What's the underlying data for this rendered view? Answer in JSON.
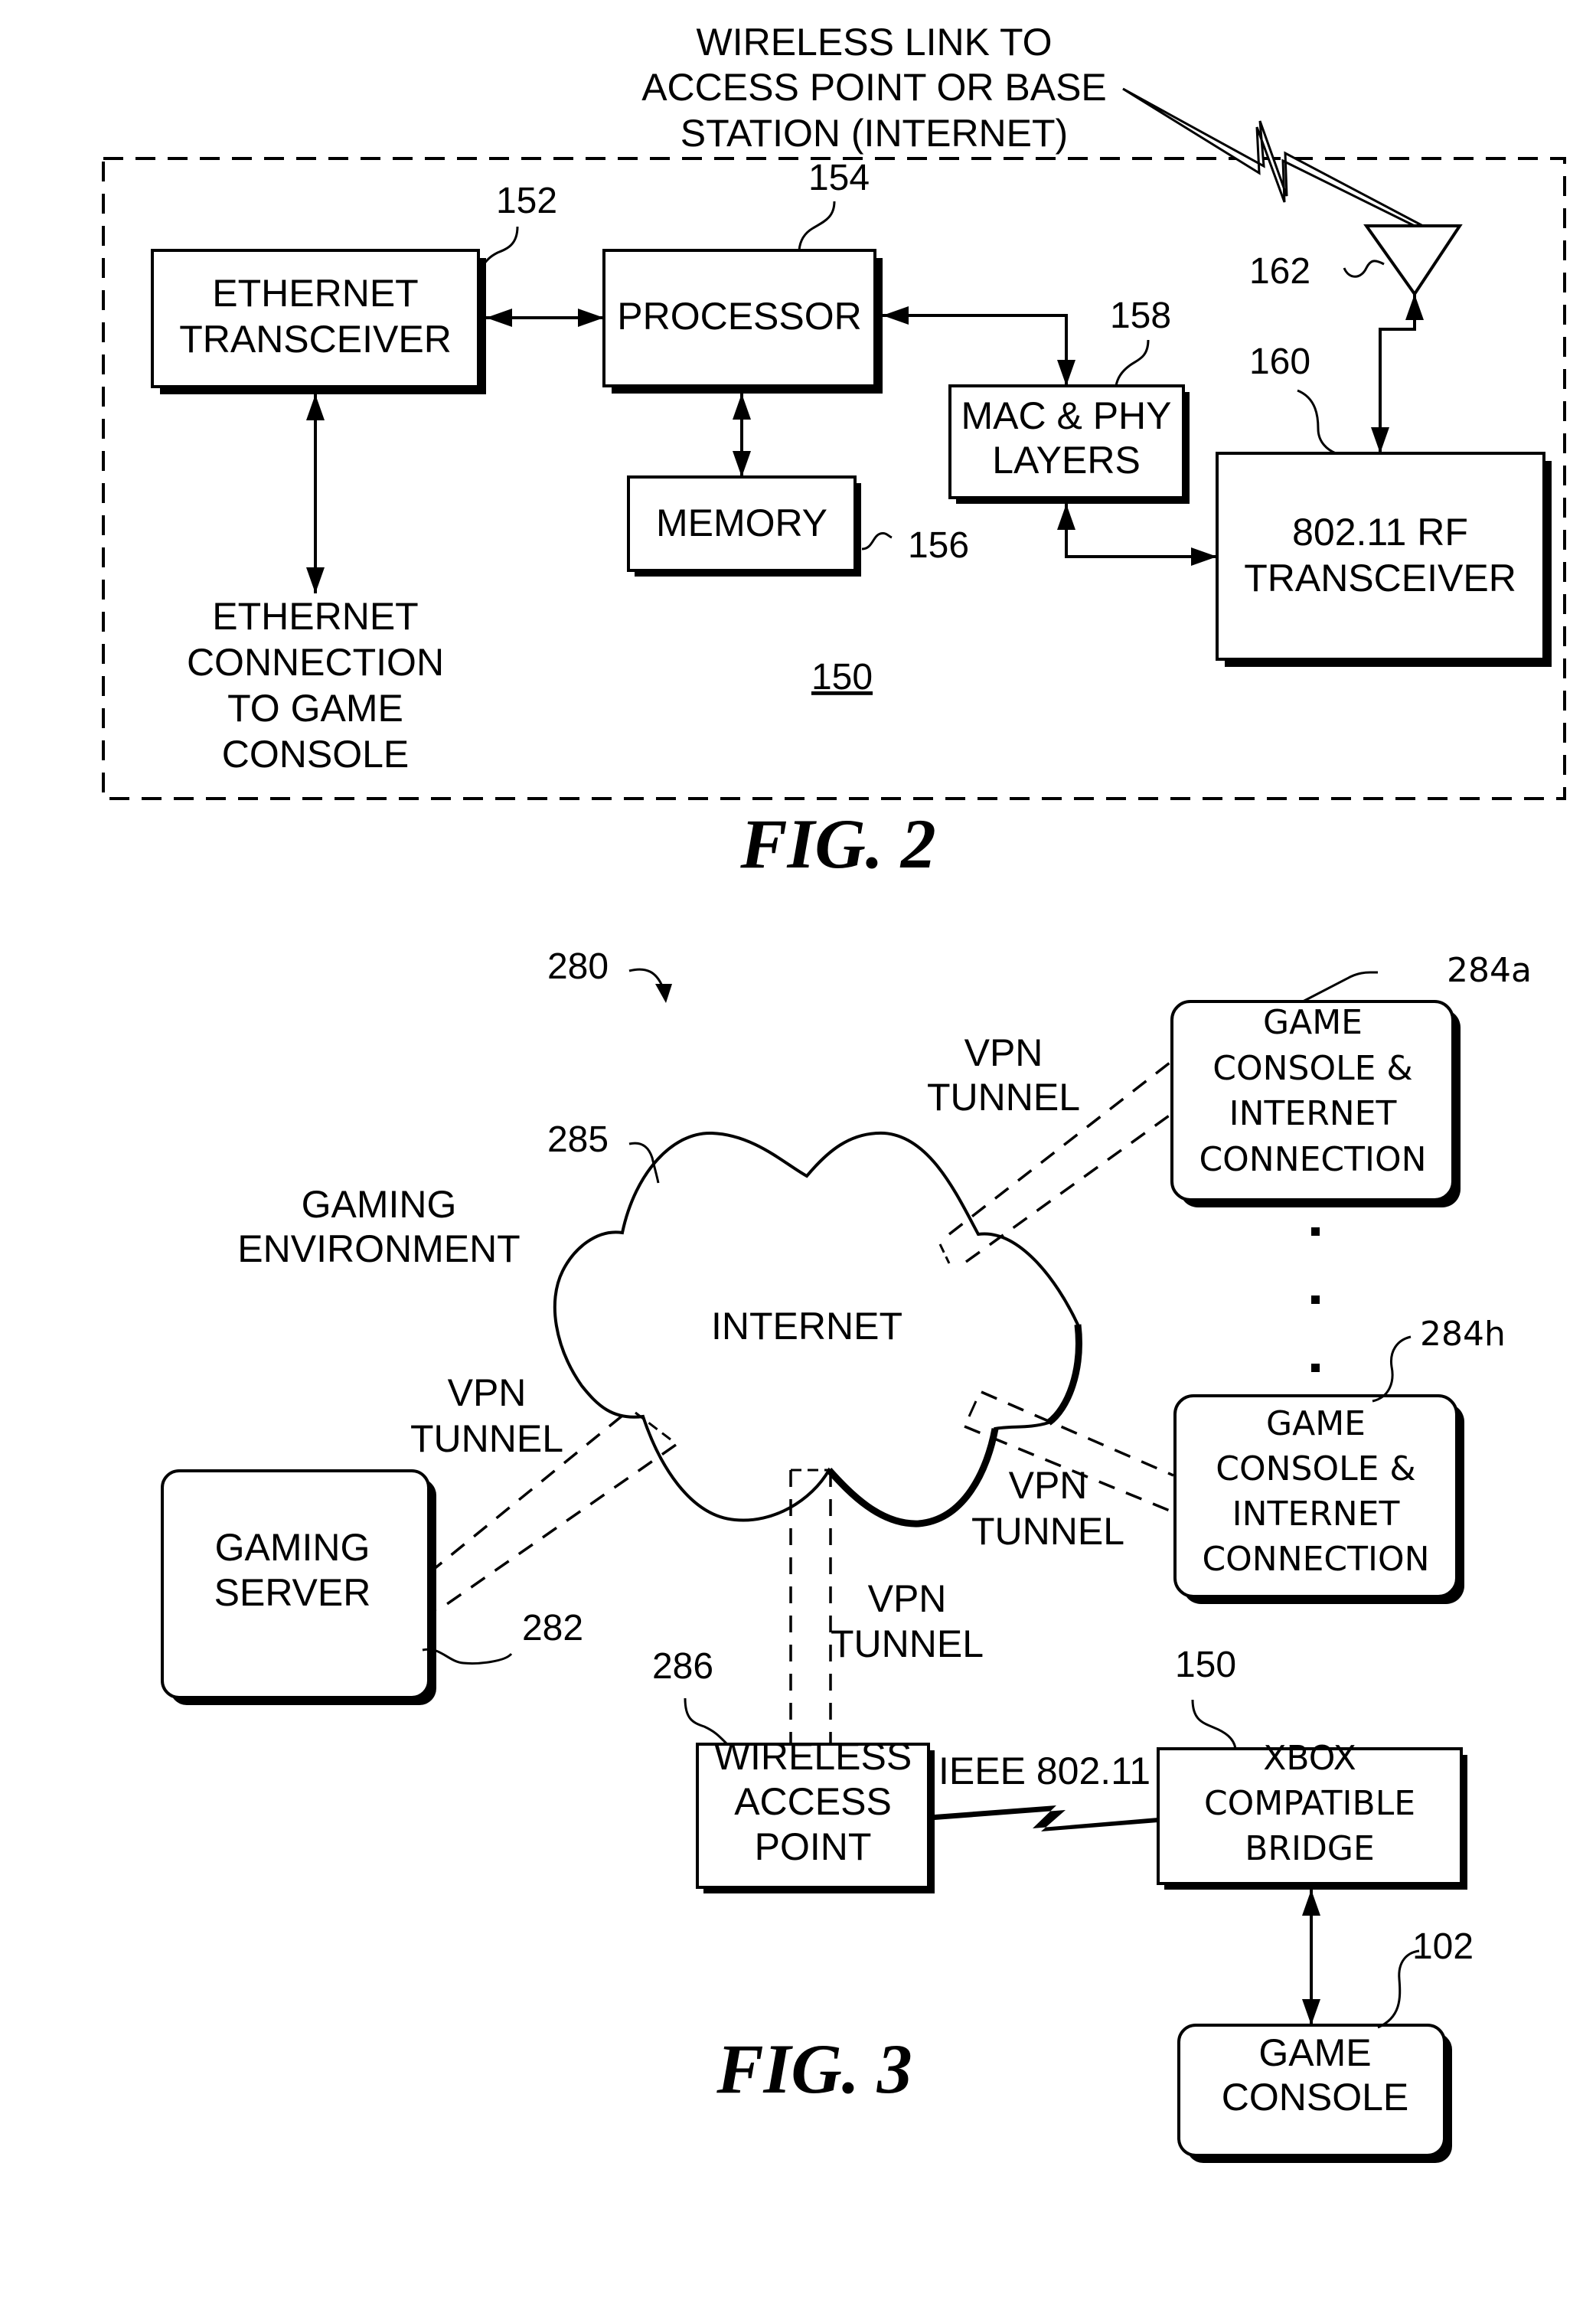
{
  "fig2": {
    "caption": "FIG. 2",
    "device_ref": "150",
    "wireless_link_label": [
      "WIRELESS LINK TO",
      "ACCESS POINT OR BASE",
      "STATION (INTERNET)"
    ],
    "ethernet_connection_label": [
      "ETHERNET",
      "CONNECTION",
      "TO GAME",
      "CONSOLE"
    ],
    "blocks": {
      "ethernet_transceiver": {
        "lines": [
          "ETHERNET",
          "TRANSCEIVER"
        ],
        "ref": "152"
      },
      "processor": {
        "lines": [
          "PROCESSOR"
        ],
        "ref": "154"
      },
      "memory": {
        "lines": [
          "MEMORY"
        ],
        "ref": "156"
      },
      "mac_phy": {
        "lines": [
          "MAC & PHY",
          "LAYERS"
        ],
        "ref": "158"
      },
      "rf_transceiver": {
        "lines": [
          "802.11 RF",
          "TRANSCEIVER"
        ],
        "ref": "160"
      },
      "antenna": {
        "ref": "162"
      }
    }
  },
  "fig3": {
    "caption": "FIG. 3",
    "system_ref": "280",
    "environment_label": [
      "GAMING",
      "ENVIRONMENT"
    ],
    "cloud": {
      "label": "INTERNET",
      "ref": "285"
    },
    "vpn_label": [
      "VPN",
      "TUNNEL"
    ],
    "wireless_link_label": "IEEE 802.11",
    "ellipsis": [
      "▪",
      "▪",
      "▪"
    ],
    "blocks": {
      "console_a": {
        "lines": [
          "GAME",
          "CONSOLE &",
          "INTERNET",
          "CONNECTION"
        ],
        "ref": "284a"
      },
      "console_h": {
        "lines": [
          "GAME",
          "CONSOLE &",
          "INTERNET",
          "CONNECTION"
        ],
        "ref": "284h"
      },
      "gaming_server": {
        "lines": [
          "GAMING",
          "SERVER"
        ],
        "ref": "282"
      },
      "access_point": {
        "lines": [
          "WIRELESS",
          "ACCESS",
          "POINT"
        ],
        "ref": "286"
      },
      "bridge": {
        "lines": [
          "XBOX",
          "COMPATIBLE",
          "BRIDGE"
        ],
        "ref": "150"
      },
      "game_console": {
        "lines": [
          "GAME",
          "CONSOLE"
        ],
        "ref": "102"
      }
    }
  }
}
